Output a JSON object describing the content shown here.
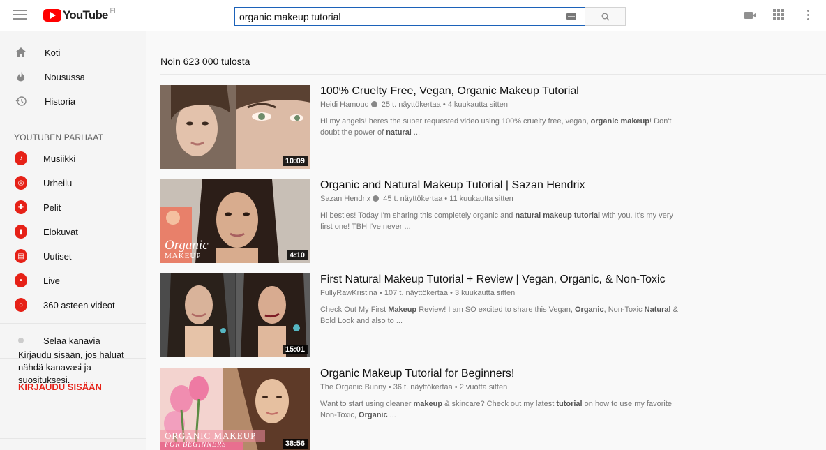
{
  "header": {
    "logo_text": "YouTube",
    "logo_region": "FI",
    "search_value": "organic makeup tutorial"
  },
  "sidebar": {
    "main_items": [
      {
        "label": "Koti",
        "icon": "home-icon"
      },
      {
        "label": "Nousussa",
        "icon": "trending-icon"
      },
      {
        "label": "Historia",
        "icon": "history-icon"
      }
    ],
    "section_title": "YOUTUBEN PARHAAT",
    "best_items": [
      {
        "label": "Musiikki",
        "icon": "music-icon"
      },
      {
        "label": "Urheilu",
        "icon": "sports-icon"
      },
      {
        "label": "Pelit",
        "icon": "gaming-icon"
      },
      {
        "label": "Elokuvat",
        "icon": "movies-icon"
      },
      {
        "label": "Uutiset",
        "icon": "news-icon"
      },
      {
        "label": "Live",
        "icon": "live-icon"
      },
      {
        "label": "360 asteen videot",
        "icon": "360-video-icon"
      }
    ],
    "browse_channels": "Selaa kanavia",
    "signin_prompt": "Kirjaudu sisään, jos haluat nähdä kanavasi ja suosituksesi.",
    "signin_link": "KIRJAUDU SISÄÄN"
  },
  "results": {
    "count_label": "Noin 623 000 tulosta",
    "items": [
      {
        "title": "100% Cruelty Free, Vegan, Organic Makeup Tutorial",
        "channel": "Heidi Hamoud",
        "verified": true,
        "stats": "25 t. näyttökertaa • 4 kuukautta sitten",
        "description_html": "Hi my angels! heres the super requested video using 100% cruelty free, vegan, <b>organic makeup</b>! Don't doubt the power of <b>natural</b> ...",
        "duration": "10:09"
      },
      {
        "title": "Organic and Natural Makeup Tutorial | Sazan Hendrix",
        "channel": "Sazan Hendrix",
        "verified": true,
        "stats": "45 t. näyttökertaa • 11 kuukautta sitten",
        "description_html": "Hi besties! Today I'm sharing this completely organic and <b>natural makeup tutorial</b> with you. It's my very first one! TBH I've never ...",
        "duration": "4:10",
        "thumb_text_1": "Organic",
        "thumb_text_2": "MAKEUP"
      },
      {
        "title": "First Natural Makeup Tutorial + Review | Vegan, Organic, & Non-Toxic",
        "channel": "FullyRawKristina",
        "verified": false,
        "stats": "107 t. näyttökertaa • 3 kuukautta sitten",
        "description_html": "Check Out My First <b>Makeup</b> Review! I am SO excited to share this Vegan, <b>Organic</b>, Non-Toxic <b>Natural</b> &amp; Bold Look and also to ...",
        "duration": "15:01"
      },
      {
        "title": "Organic Makeup Tutorial for Beginners!",
        "channel": "The Organic Bunny",
        "verified": false,
        "stats": "36 t. näyttökertaa • 2 vuotta sitten",
        "description_html": "Want to start using cleaner <b>makeup</b> &amp; skincare? Check out my latest <b>tutorial</b> on how to use my favorite Non-Toxic, <b>Organic</b> ...",
        "duration": "38:56",
        "thumb_text_1": "ORGANIC MAKEUP",
        "thumb_text_2": "FOR BEGINNERS"
      }
    ]
  },
  "colors": {
    "brand_red": "#ff0000",
    "category_red": "#e62117",
    "search_border": "#1c62b9"
  }
}
